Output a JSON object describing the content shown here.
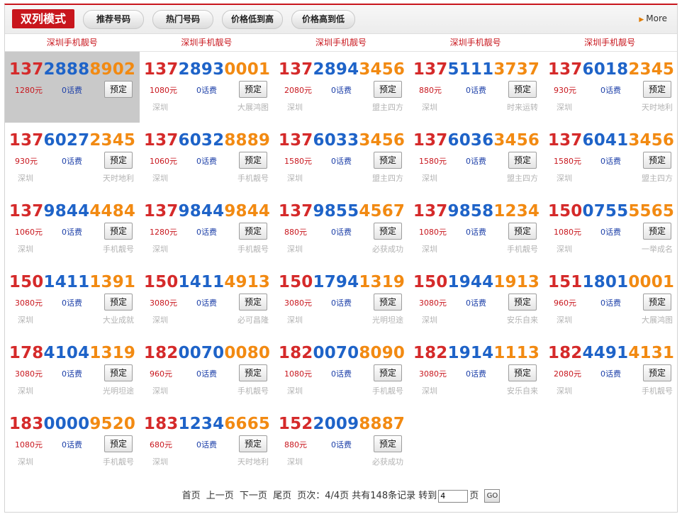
{
  "toolbar": {
    "mode_label": "双列模式",
    "tabs": [
      "推荐号码",
      "热门号码",
      "价格低到高",
      "价格高到低"
    ],
    "more_label": "More"
  },
  "headers": [
    "深圳手机靓号",
    "深圳手机靓号",
    "深圳手机靓号",
    "深圳手机靓号",
    "深圳手机靓号"
  ],
  "book_label": "预定",
  "colors": {
    "accent": "#c8161d",
    "num_red": "#d52a2a",
    "num_blue": "#1e63c8",
    "num_orange": "#f28a12"
  },
  "numbers": [
    {
      "p1": "137",
      "p2": "2888",
      "p3": "8902",
      "price": "1280元",
      "fee": "0话费",
      "city": "",
      "tag": "",
      "selected": true
    },
    {
      "p1": "137",
      "p2": "2893",
      "p3": "0001",
      "price": "1080元",
      "fee": "0话费",
      "city": "深圳",
      "tag": "大展鸿图"
    },
    {
      "p1": "137",
      "p2": "2894",
      "p3": "3456",
      "price": "2080元",
      "fee": "0话费",
      "city": "深圳",
      "tag": "盟主四方"
    },
    {
      "p1": "137",
      "p2": "5111",
      "p3": "3737",
      "price": "880元",
      "fee": "0话费",
      "city": "深圳",
      "tag": "时来运转"
    },
    {
      "p1": "137",
      "p2": "6018",
      "p3": "2345",
      "price": "930元",
      "fee": "0话费",
      "city": "深圳",
      "tag": "天时地利"
    },
    {
      "p1": "137",
      "p2": "6027",
      "p3": "2345",
      "price": "930元",
      "fee": "0话费",
      "city": "深圳",
      "tag": "天时地利"
    },
    {
      "p1": "137",
      "p2": "6032",
      "p3": "8889",
      "price": "1060元",
      "fee": "0话费",
      "city": "深圳",
      "tag": "手机靓号"
    },
    {
      "p1": "137",
      "p2": "6033",
      "p3": "3456",
      "price": "1580元",
      "fee": "0话费",
      "city": "深圳",
      "tag": "盟主四方"
    },
    {
      "p1": "137",
      "p2": "6036",
      "p3": "3456",
      "price": "1580元",
      "fee": "0话费",
      "city": "深圳",
      "tag": "盟主四方"
    },
    {
      "p1": "137",
      "p2": "6041",
      "p3": "3456",
      "price": "1580元",
      "fee": "0话费",
      "city": "深圳",
      "tag": "盟主四方"
    },
    {
      "p1": "137",
      "p2": "9844",
      "p3": "4484",
      "price": "1060元",
      "fee": "0话费",
      "city": "深圳",
      "tag": "手机靓号"
    },
    {
      "p1": "137",
      "p2": "9844",
      "p3": "9844",
      "price": "1280元",
      "fee": "0话费",
      "city": "深圳",
      "tag": "手机靓号"
    },
    {
      "p1": "137",
      "p2": "9855",
      "p3": "4567",
      "price": "880元",
      "fee": "0话费",
      "city": "深圳",
      "tag": "必获成功"
    },
    {
      "p1": "137",
      "p2": "9858",
      "p3": "1234",
      "price": "1080元",
      "fee": "0话费",
      "city": "深圳",
      "tag": "手机靓号"
    },
    {
      "p1": "150",
      "p2": "0755",
      "p3": "5565",
      "price": "1080元",
      "fee": "0话费",
      "city": "深圳",
      "tag": "一举成名"
    },
    {
      "p1": "150",
      "p2": "1411",
      "p3": "1391",
      "price": "3080元",
      "fee": "0话费",
      "city": "深圳",
      "tag": "大业成就"
    },
    {
      "p1": "150",
      "p2": "1411",
      "p3": "4913",
      "price": "3080元",
      "fee": "0话费",
      "city": "深圳",
      "tag": "必可昌隆"
    },
    {
      "p1": "150",
      "p2": "1794",
      "p3": "1319",
      "price": "3080元",
      "fee": "0话费",
      "city": "深圳",
      "tag": "光明坦途"
    },
    {
      "p1": "150",
      "p2": "1944",
      "p3": "1913",
      "price": "3080元",
      "fee": "0话费",
      "city": "深圳",
      "tag": "安乐自来"
    },
    {
      "p1": "151",
      "p2": "1801",
      "p3": "0001",
      "price": "960元",
      "fee": "0话费",
      "city": "深圳",
      "tag": "大展鸿图"
    },
    {
      "p1": "178",
      "p2": "4104",
      "p3": "1319",
      "price": "3080元",
      "fee": "0话费",
      "city": "深圳",
      "tag": "光明坦途"
    },
    {
      "p1": "182",
      "p2": "0070",
      "p3": "0080",
      "price": "960元",
      "fee": "0话费",
      "city": "深圳",
      "tag": "手机靓号"
    },
    {
      "p1": "182",
      "p2": "0070",
      "p3": "8090",
      "price": "1080元",
      "fee": "0话费",
      "city": "深圳",
      "tag": "手机靓号"
    },
    {
      "p1": "182",
      "p2": "1914",
      "p3": "1113",
      "price": "3080元",
      "fee": "0话费",
      "city": "深圳",
      "tag": "安乐自来"
    },
    {
      "p1": "182",
      "p2": "4491",
      "p3": "4131",
      "price": "2080元",
      "fee": "0话费",
      "city": "深圳",
      "tag": "手机靓号"
    },
    {
      "p1": "183",
      "p2": "0000",
      "p3": "9520",
      "price": "1080元",
      "fee": "0话费",
      "city": "深圳",
      "tag": "手机靓号"
    },
    {
      "p1": "183",
      "p2": "1234",
      "p3": "6665",
      "price": "680元",
      "fee": "0话费",
      "city": "深圳",
      "tag": "天时地利"
    },
    {
      "p1": "152",
      "p2": "2009",
      "p3": "8887",
      "price": "880元",
      "fee": "0话费",
      "city": "深圳",
      "tag": "必获成功"
    }
  ],
  "pagination": {
    "first": "首页",
    "prev": "上一页",
    "next": "下一页",
    "last": "尾页",
    "info": "页次：4/4页 共有148条记录 转到",
    "goto_value": "4",
    "page_suffix": "页",
    "go_label": "GO"
  }
}
